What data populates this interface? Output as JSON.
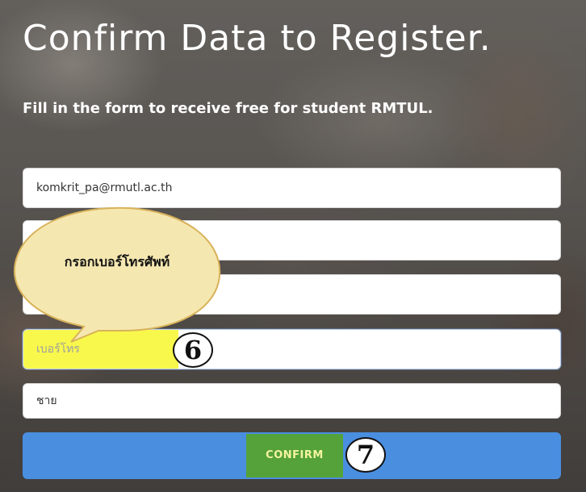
{
  "page": {
    "title": "Confirm Data to Register.",
    "subtitle": "Fill in the form to receive free for student RMTUL."
  },
  "form": {
    "email_value": "komkrit_pa@rmutl.ac.th",
    "field2_value": "",
    "field3_value": "",
    "phone_placeholder": "เบอร์โทร",
    "phone_value": "",
    "gender_options": [
      "ชาย"
    ],
    "gender_selected": "ชาย",
    "confirm_label": "CONFIRM"
  },
  "annotations": {
    "callout_text": "กรอกเบอร์โทรศัพท์",
    "step_phone": "6",
    "step_confirm": "7"
  },
  "colors": {
    "accent_button": "#4a8ee0",
    "confirm_highlight": "#56a23a",
    "field_highlight": "#f8f84c",
    "callout_fill": "#f5e7b0"
  }
}
